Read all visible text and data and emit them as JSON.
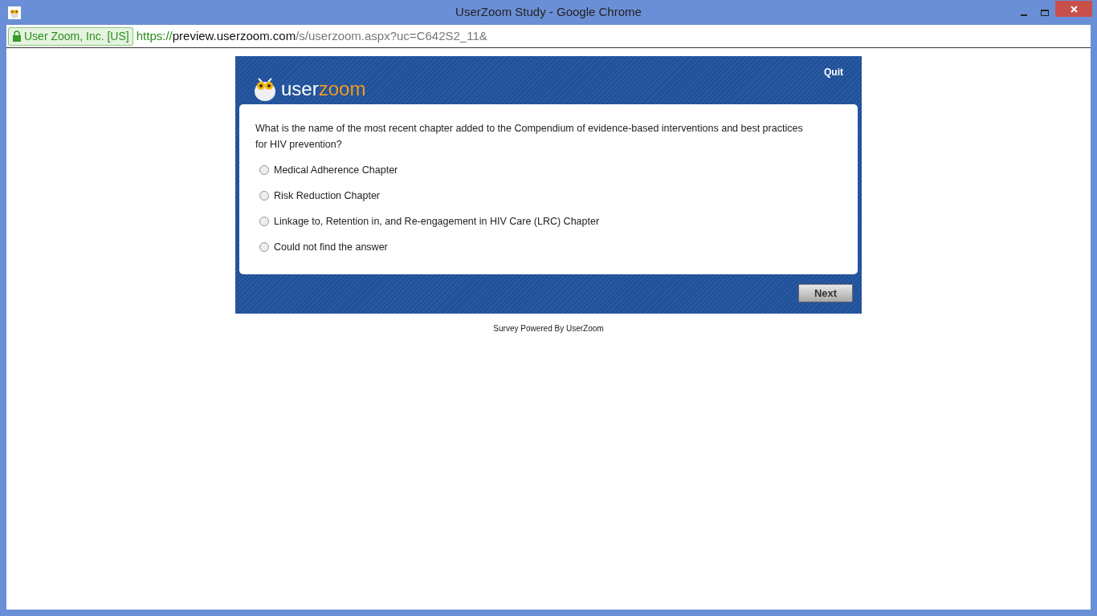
{
  "window": {
    "title": "UserZoom Study - Google Chrome"
  },
  "address_bar": {
    "security_badge": "User Zoom, Inc. [US]",
    "url": {
      "scheme": "https://",
      "host": "preview.userzoom.com",
      "path": "/s/userzoom.aspx?uc=C642S2_11&"
    }
  },
  "survey": {
    "logo": {
      "first": "user",
      "second": "zoom"
    },
    "quit": "Quit",
    "question": "What is the name of the most recent chapter added to the Compendium of evidence-based interventions and best practices for HIV prevention?",
    "options": [
      {
        "label": "Medical Adherence Chapter",
        "selected": false
      },
      {
        "label": "Risk Reduction Chapter",
        "selected": false
      },
      {
        "label": "Linkage to, Retention in, and Re-engagement in HIV Care (LRC) Chapter",
        "selected": false
      },
      {
        "label": "Could not find the answer",
        "selected": false
      }
    ],
    "next_button": "Next"
  },
  "footer": "Survey Powered By UserZoom"
}
